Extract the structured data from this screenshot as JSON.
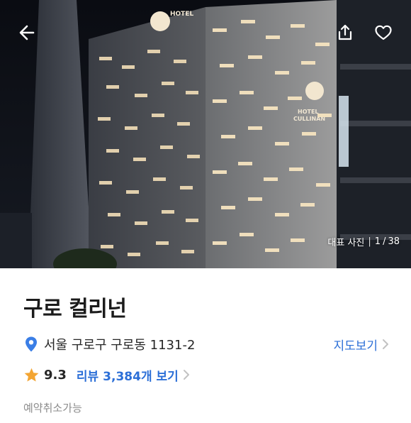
{
  "hero": {
    "photo_alt": "HOTEL CULLINAN",
    "photo_category": "대표 사진",
    "photo_current": "1",
    "photo_total": "38",
    "photo_separator": "/"
  },
  "header": {
    "back_icon": "arrow-left-icon",
    "share_icon": "share-icon",
    "favorite_icon": "heart-outline-icon"
  },
  "hotel": {
    "name": "구로 컬리넌",
    "address": "서울 구로구 구로동 1131-2",
    "map_link_label": "지도보기",
    "rating_score": "9.3",
    "review_label": "리뷰",
    "review_count_label": "3,384개 보기",
    "cancel_policy": "예약취소가능"
  },
  "colors": {
    "link_blue": "#2c6fd7",
    "pin_blue": "#3a7ee6",
    "star_orange": "#f3a533",
    "text_dark": "#1b1b1b",
    "text_muted": "#8c8c8c"
  }
}
